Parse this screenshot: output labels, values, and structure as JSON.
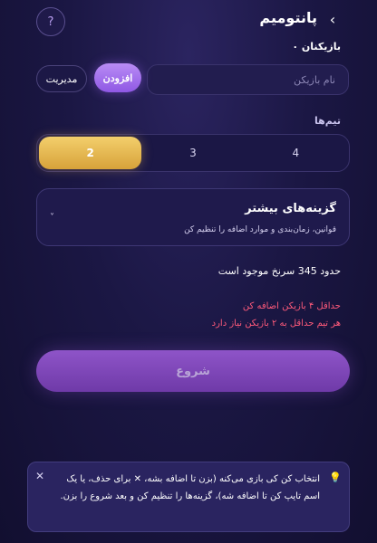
{
  "header": {
    "title": "پانتومیم",
    "back_icon": "›",
    "help_icon": "?"
  },
  "players": {
    "count_label": "بازیکنان ۰",
    "input_placeholder": "نام بازیکن",
    "add_label": "افزودن",
    "manage_label": "مدیریت"
  },
  "teams": {
    "label": "تیم‌ها",
    "options": [
      "2",
      "3",
      "4"
    ],
    "selected": "2"
  },
  "more_options": {
    "title": "گزینه‌های بیشتر",
    "subtitle": "قوانین، زمان‌بندی و موارد اضافه را تنظیم کن",
    "chevron": "˅"
  },
  "words_available": "حدود 345 سرنخ موجود است",
  "errors": [
    "حداقل ۴ بازیکن اضافه کن",
    "هر تیم حداقل به ۲ بازیکن نیاز دارد"
  ],
  "start_label": "شروع",
  "hint": {
    "text": "انتخاب کن کی بازی می‌کنه (بزن تا اضافه بشه، ✕ برای حذف، یا یک اسم تایپ کن تا اضافه شه)، گزینه‌ها را تنظیم کن و بعد شروع را بزن.",
    "close_icon": "✕",
    "bulb_icon": "💡"
  },
  "colors": {
    "accent_purple": "#9b64f0",
    "accent_gold": "#e8b54e",
    "error": "#ff5a7a"
  }
}
